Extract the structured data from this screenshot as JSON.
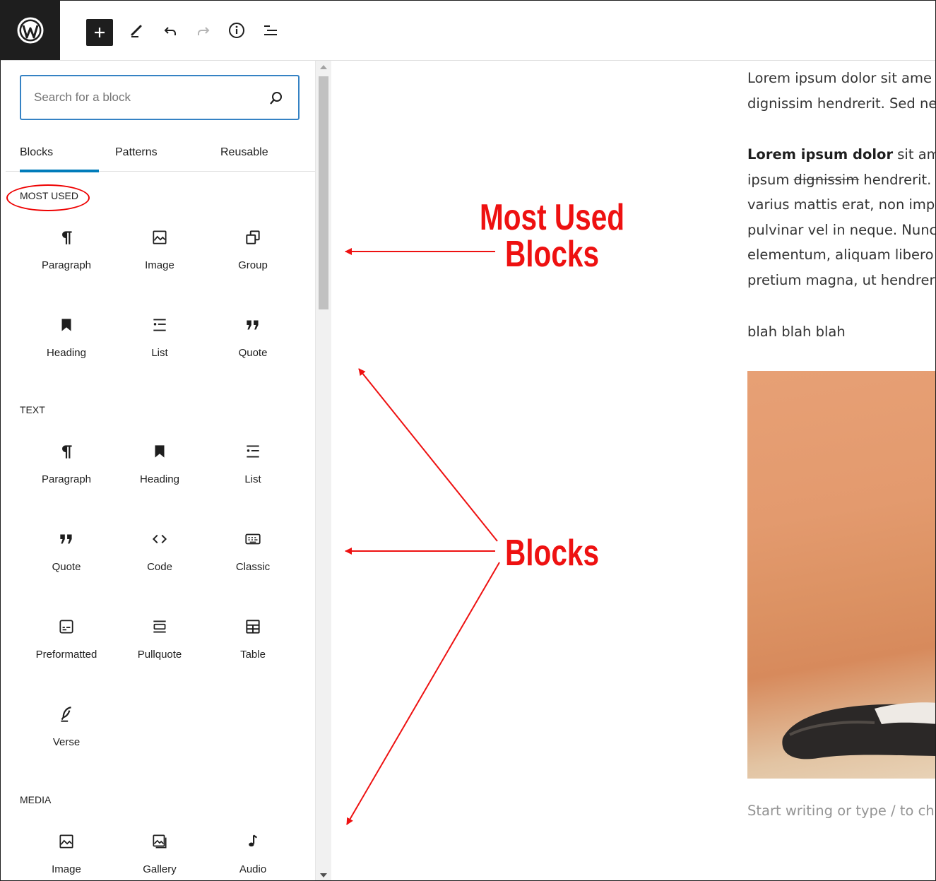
{
  "toolbar": {
    "logo_icon": "wordpress-icon",
    "icons": [
      "add-icon",
      "edit-icon",
      "undo-icon",
      "redo-icon",
      "info-icon",
      "list-view-icon"
    ]
  },
  "inserter": {
    "search_placeholder": "Search for a block",
    "tabs": [
      "Blocks",
      "Patterns",
      "Reusable"
    ],
    "active_tab": "Blocks",
    "categories": [
      {
        "title": "MOST USED",
        "blocks": [
          {
            "label": "Paragraph",
            "icon": "paragraph-icon"
          },
          {
            "label": "Image",
            "icon": "image-icon"
          },
          {
            "label": "Group",
            "icon": "group-icon"
          },
          {
            "label": "Heading",
            "icon": "heading-icon"
          },
          {
            "label": "List",
            "icon": "list-icon"
          },
          {
            "label": "Quote",
            "icon": "quote-icon"
          }
        ]
      },
      {
        "title": "TEXT",
        "blocks": [
          {
            "label": "Paragraph",
            "icon": "paragraph-icon"
          },
          {
            "label": "Heading",
            "icon": "heading-icon"
          },
          {
            "label": "List",
            "icon": "list-icon"
          },
          {
            "label": "Quote",
            "icon": "quote-icon"
          },
          {
            "label": "Code",
            "icon": "code-icon"
          },
          {
            "label": "Classic",
            "icon": "classic-icon"
          },
          {
            "label": "Preformatted",
            "icon": "preformatted-icon"
          },
          {
            "label": "Pullquote",
            "icon": "pullquote-icon"
          },
          {
            "label": "Table",
            "icon": "table-icon"
          },
          {
            "label": "Verse",
            "icon": "verse-icon"
          }
        ]
      },
      {
        "title": "MEDIA",
        "blocks": [
          {
            "label": "Image",
            "icon": "image-icon"
          },
          {
            "label": "Gallery",
            "icon": "gallery-icon"
          },
          {
            "label": "Audio",
            "icon": "audio-icon"
          }
        ]
      }
    ]
  },
  "editor": {
    "p1": [
      "Lorem ipsum dolor sit ame",
      "dignissim hendrerit. Sed ne"
    ],
    "p2_bold": "Lorem ipsum dolor",
    "p2_line1_rest": " sit am",
    "p2_line2_start": "ipsum ",
    "p2_strike": "dignissim",
    "p2_line2_rest": " hendrerit.",
    "p2_lines": [
      "varius mattis erat, non imp",
      "pulvinar vel in neque. Nunc",
      "elementum, aliquam libero",
      "pretium magna, ut hendrer"
    ],
    "p3": "blah blah blah",
    "placeholder": "Start writing or type / to ch"
  },
  "annotations": {
    "most_used_line1": "Most Used",
    "most_used_line2": "Blocks",
    "blocks": "Blocks",
    "color": "#ee1111"
  }
}
